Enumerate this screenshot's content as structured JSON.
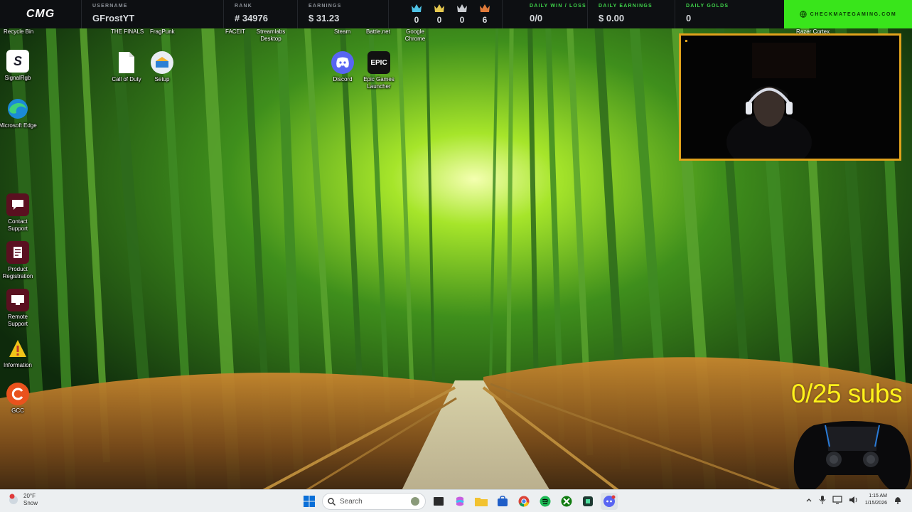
{
  "topbar": {
    "logo": "CMG",
    "username_label": "USERNAME",
    "username": "GFrostYT",
    "rank_label": "RANK",
    "rank": "# 34976",
    "earnings_label": "EARNINGS",
    "earnings": "$ 31.23",
    "crowns": [
      {
        "count": "0",
        "color": "#4fc3e6",
        "icon": "crown-icon"
      },
      {
        "count": "0",
        "color": "#e6c84f",
        "icon": "crown-icon"
      },
      {
        "count": "0",
        "color": "#c9ccd1",
        "icon": "crown-icon"
      },
      {
        "count": "6",
        "color": "#e07a3a",
        "icon": "crown-icon"
      }
    ],
    "daily_winloss_label": "DAILY WIN / LOSS",
    "daily_winloss": "0/0",
    "daily_earnings_label": "DAILY EARNINGS",
    "daily_earnings": "$ 0.00",
    "daily_golds_label": "DAILY GOLDS",
    "daily_golds": "0",
    "site": "CHECKMATEGAMING.COM",
    "site_color": "#39e51b"
  },
  "desktop": {
    "top_row_labels": [
      "Recycle Bin",
      "THE FINALS",
      "FragPunk",
      "FACEIT",
      "Streamlabs Desktop",
      "Steam",
      "Battle.net",
      "Google Chrome",
      "Razer Cortex"
    ],
    "icons": [
      {
        "label": "SignalRgb",
        "icon": "signalrgb-icon"
      },
      {
        "label": "Microsoft Edge",
        "icon": "edge-icon"
      },
      {
        "label": "Call of Duty",
        "icon": "file-icon"
      },
      {
        "label": "Setup",
        "icon": "setup-icon"
      },
      {
        "label": "Discord",
        "icon": "discord-icon"
      },
      {
        "label": "Epic Games Launcher",
        "icon": "epic-icon",
        "glyph": "EPIC"
      },
      {
        "label": "Contact Support",
        "icon": "contact-support-icon"
      },
      {
        "label": "Product Registration",
        "icon": "product-registration-icon"
      },
      {
        "label": "Remote Support",
        "icon": "remote-support-icon"
      },
      {
        "label": "Information",
        "icon": "information-icon"
      },
      {
        "label": "GCC",
        "icon": "gcc-icon"
      }
    ]
  },
  "overlay": {
    "subs": "0/25 subs",
    "subs_color": "#fff21a",
    "webcam_border": "#e0a21c"
  },
  "taskbar": {
    "weather_temp": "20°F",
    "weather_cond": "Snow",
    "weather_badge": "2",
    "search_placeholder": "Search",
    "apps": [
      "windows-start-icon",
      "search-icon",
      "file-explorer-icon",
      "copilot-icon",
      "folder-icon",
      "store-icon",
      "chrome-icon",
      "spotify-icon",
      "xbox-icon",
      "app-icon",
      "discord-icon"
    ],
    "time": "1:15 AM",
    "date": "1/15/2026"
  }
}
